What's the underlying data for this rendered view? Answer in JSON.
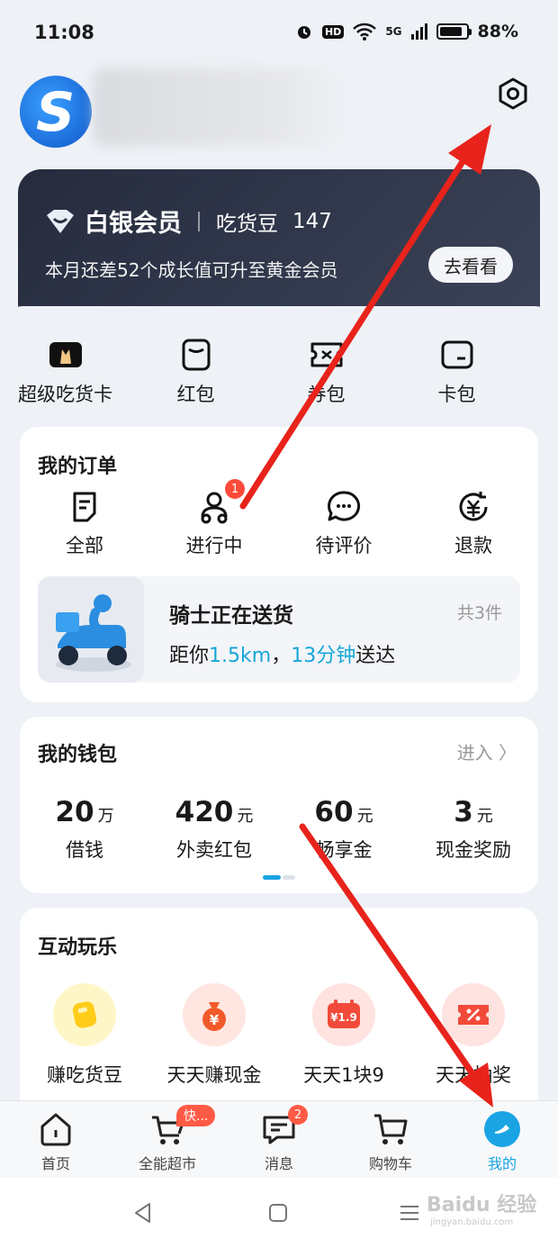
{
  "status_bar": {
    "time": "11:08",
    "hd": "HD",
    "network": "5G",
    "battery": "88%"
  },
  "profile": {
    "avatar_letter": "S"
  },
  "member": {
    "tier": "白银会员",
    "beans_label": "吃货豆",
    "beans_value": "147",
    "progress_text": "本月还差52个成长值可升至黄金会员",
    "cta": "去看看"
  },
  "quick_links": [
    {
      "label": "超级吃货卡",
      "icon": "super-card-icon"
    },
    {
      "label": "红包",
      "icon": "red-packet-icon"
    },
    {
      "label": "券包",
      "icon": "coupon-icon"
    },
    {
      "label": "卡包",
      "icon": "card-wallet-icon"
    }
  ],
  "orders": {
    "title": "我的订单",
    "items": [
      {
        "label": "全部",
        "icon": "all-orders-icon"
      },
      {
        "label": "进行中",
        "icon": "rider-icon",
        "badge": "1"
      },
      {
        "label": "待评价",
        "icon": "chat-review-icon"
      },
      {
        "label": "退款",
        "icon": "refund-icon"
      }
    ],
    "delivery": {
      "title": "骑士正在送货",
      "count": "共3件",
      "eta_prefix": "距你",
      "eta_distance": "1.5km",
      "eta_sep": "，",
      "eta_time": "13分钟",
      "eta_suffix": "送达"
    }
  },
  "wallet": {
    "title": "我的钱包",
    "enter": "进入 〉",
    "items": [
      {
        "value": "20",
        "unit": "万",
        "label": "借钱"
      },
      {
        "value": "420",
        "unit": "元",
        "label": "外卖红包"
      },
      {
        "value": "60",
        "unit": "元",
        "label": "畅享金"
      },
      {
        "value": "3",
        "unit": "元",
        "label": "现金奖励"
      }
    ]
  },
  "fun": {
    "title": "互动玩乐",
    "items": [
      {
        "label": "赚吃货豆",
        "icon": "bean-icon"
      },
      {
        "label": "天天赚现金",
        "icon": "money-bag-icon"
      },
      {
        "label": "天天1块9",
        "icon": "price-tag-icon",
        "badge": "¥1.9"
      },
      {
        "label": "天天抽奖",
        "icon": "lottery-ticket-icon"
      }
    ]
  },
  "bottom_nav": [
    {
      "label": "首页",
      "icon": "home-icon"
    },
    {
      "label": "全能超市",
      "icon": "market-icon",
      "badge": "快..."
    },
    {
      "label": "消息",
      "icon": "message-icon",
      "badge": "2"
    },
    {
      "label": "购物车",
      "icon": "cart-icon"
    },
    {
      "label": "我的",
      "icon": "profile-icon",
      "active": true
    }
  ],
  "watermark": {
    "brand": "Baidu 经验",
    "url": "jingyan.baidu.com"
  },
  "colors": {
    "accent": "#1aa4e4",
    "badge": "#ff4a3a",
    "member_card": "#2d3346",
    "arrow": "#e8231b"
  }
}
